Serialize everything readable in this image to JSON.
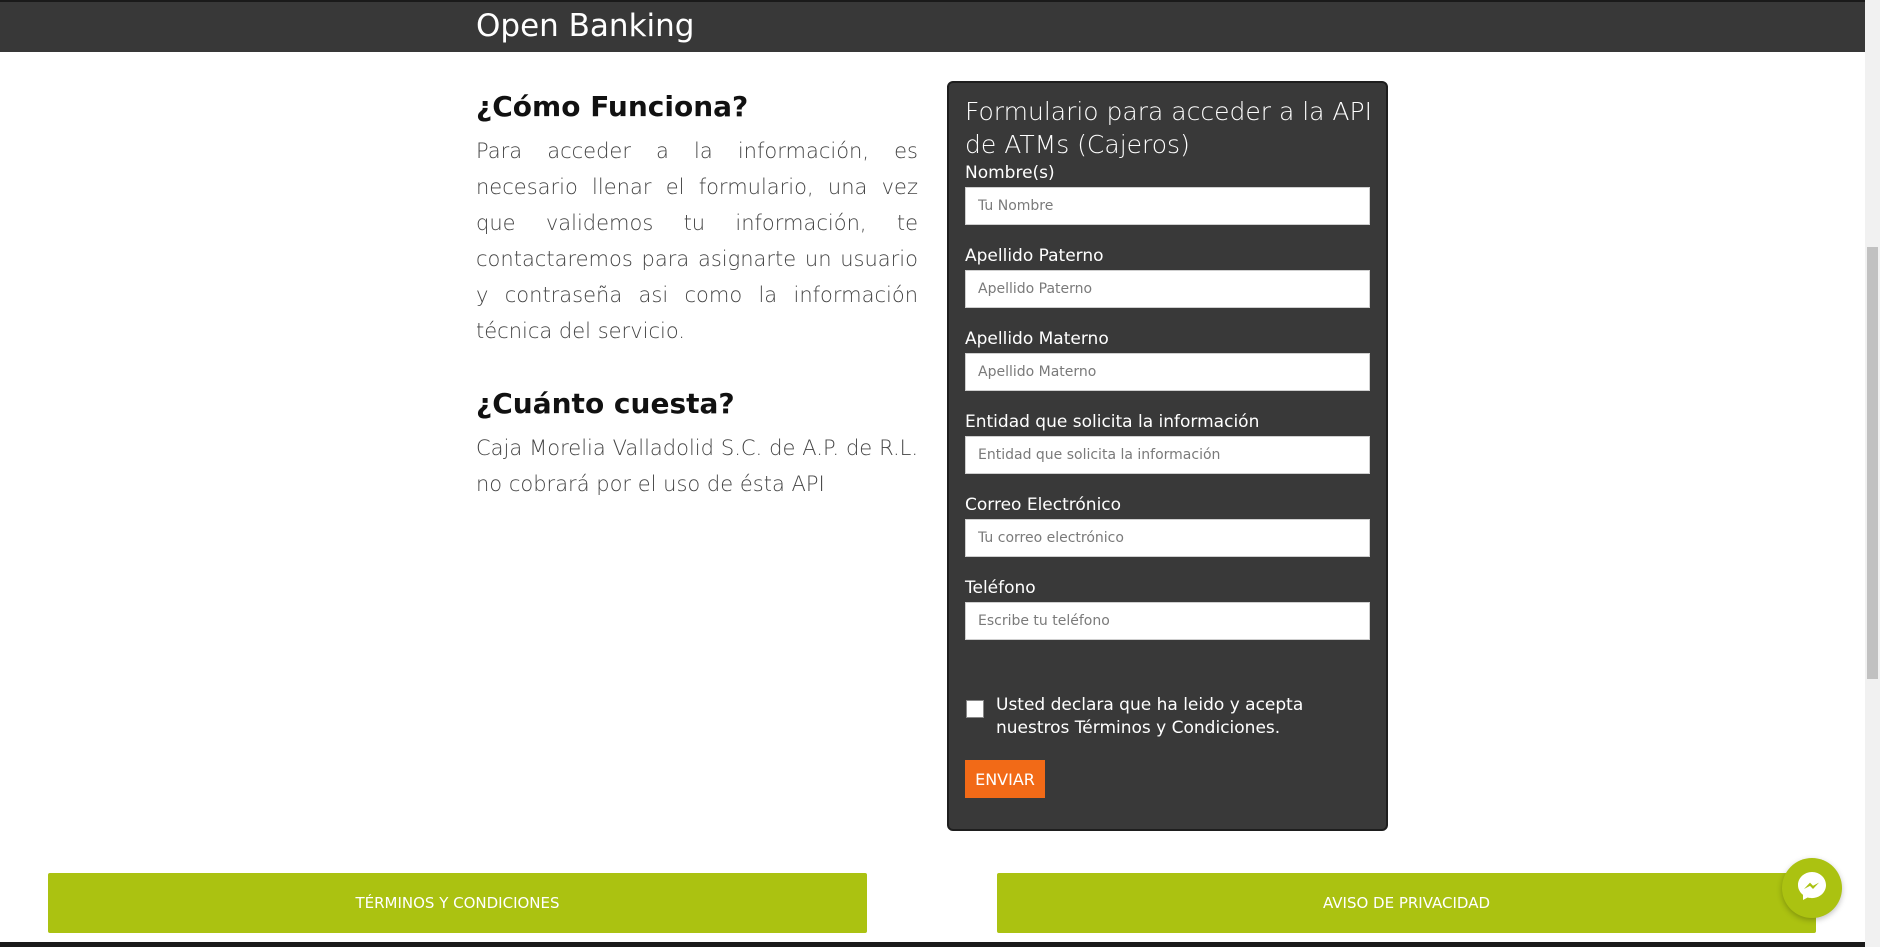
{
  "header": {
    "title": "Open Banking"
  },
  "how": {
    "heading": "¿Cómo Funciona?",
    "text": "Para acceder a la información, es necesario llenar el formulario, una vez que validemos tu información, te contactaremos para asignarte un usuario y contraseña asi como la información técnica del servicio."
  },
  "cost": {
    "heading": "¿Cuánto cuesta?",
    "text": "Caja Morelia Valladolid S.C. de A.P. de R.L. no cobrará por el uso de ésta API"
  },
  "form": {
    "title": "Formulario para acceder a la API de ATMs (Cajeros)",
    "fields": [
      {
        "label": "Nombre(s)",
        "placeholder": "Tu Nombre",
        "value": ""
      },
      {
        "label": "Apellido Paterno",
        "placeholder": "Apellido Paterno",
        "value": ""
      },
      {
        "label": "Apellido Materno",
        "placeholder": "Apellido Materno",
        "value": ""
      },
      {
        "label": "Entidad que solicita la información",
        "placeholder": "Entidad que solicita la información",
        "value": ""
      },
      {
        "label": "Correo Electrónico",
        "placeholder": "Tu correo electrónico",
        "value": ""
      },
      {
        "label": "Teléfono",
        "placeholder": "Escribe tu teléfono",
        "value": ""
      }
    ],
    "terms_text": "Usted declara que ha leido y acepta nuestros Términos y Condiciones.",
    "terms_checked": false,
    "submit_label": "ENVIAR"
  },
  "footer": {
    "terms_label": "TÉRMINOS Y CONDICIONES",
    "privacy_label": "AVISO DE PRIVACIDAD"
  },
  "icons": {
    "chat": "messenger-icon"
  },
  "colors": {
    "header_bg": "#383838",
    "form_bg": "#393939",
    "accent_green": "#abc211",
    "submit_orange": "#f26a17"
  }
}
